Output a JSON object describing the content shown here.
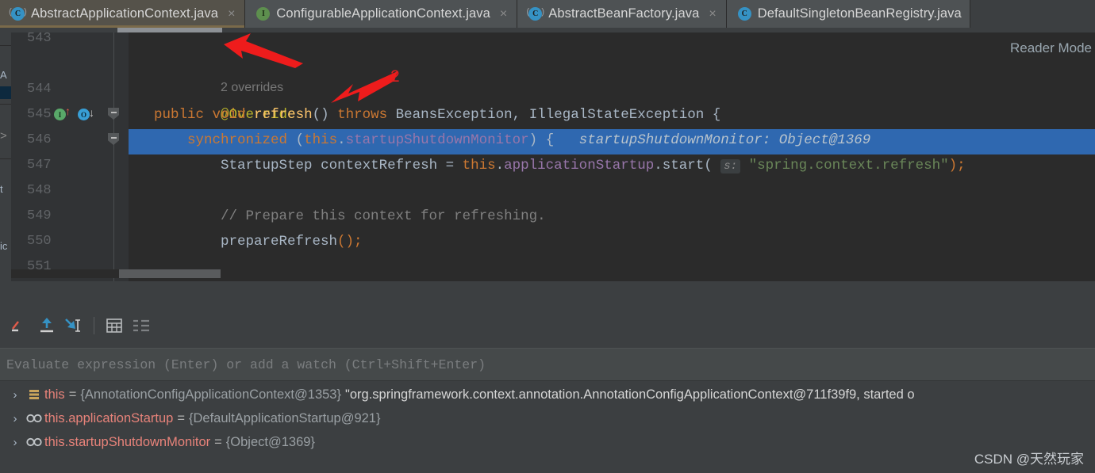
{
  "window": {
    "watermark": "CSDN @天然玩家"
  },
  "tabs": [
    {
      "label": "AbstractApplicationContext.java",
      "icon": "abstract-class-icon",
      "icon_letter": "C",
      "active": true,
      "close": "×"
    },
    {
      "label": "ConfigurableApplicationContext.java",
      "icon": "interface-icon",
      "icon_letter": "I",
      "active": false,
      "close": "×"
    },
    {
      "label": "AbstractBeanFactory.java",
      "icon": "abstract-class-icon",
      "icon_letter": "C",
      "active": false,
      "close": "×"
    },
    {
      "label": "DefaultSingletonBeanRegistry.java",
      "icon": "class-icon",
      "icon_letter": "C",
      "active": false,
      "close": ""
    }
  ],
  "editor": {
    "reader_mode_label": "Reader Mode",
    "overrides_hint": "2 overrides",
    "line_numbers": [
      "543",
      "544",
      "545",
      "546",
      "547",
      "548",
      "549",
      "550",
      "551"
    ],
    "selected_line": "546",
    "gutter_icons": {
      "implements_letter": "I",
      "overrides_letter": "O",
      "implements_arrow": "↑",
      "overrides_arrow": "↓"
    },
    "code": {
      "l544_annotation": "@Override",
      "l545": {
        "kw_public": "public",
        "kw_void": "void",
        "method": "refresh",
        "parens": "()",
        "kw_throws": "throws",
        "type1": "BeansException",
        "comma": ",",
        "type2": "IllegalStateException",
        "brace": "{"
      },
      "l546": {
        "kw_sync": "synchronized",
        "open_paren": "(",
        "kw_this": "this",
        "dot": ".",
        "field": "startupShutdownMonitor",
        "close_paren": ")",
        "brace": "{",
        "debug_hint": "startupShutdownMonitor: Object@1369"
      },
      "l547": {
        "type": "StartupStep",
        "var": "contextRefresh",
        "eq": "=",
        "kw_this": "this",
        "dot": ".",
        "field": "applicationStartup",
        "dot2": ".",
        "method": "start",
        "open_paren": "(",
        "param_hint": "s:",
        "string": "\"spring.context.refresh\"",
        "close": ");"
      },
      "l549_comment": "// Prepare this context for refreshing.",
      "l550": {
        "method": "prepareRefresh",
        "tail": "();"
      }
    },
    "annotations": {
      "arrow1": "red-arrow-upper-left",
      "arrow2": "red-arrow-lower-left",
      "number_label": "2"
    }
  },
  "left_sliver": {
    "rows": [
      "A",
      "",
      ">",
      "t",
      "ic"
    ]
  },
  "debugger": {
    "toolbar": [
      {
        "name": "step-over-icon",
        "glyph": "step-over"
      },
      {
        "name": "step-out-icon",
        "glyph": "arrow-up"
      },
      {
        "name": "run-to-cursor-icon",
        "glyph": "arrow-down-right"
      },
      {
        "name": "table-view-icon",
        "glyph": "table"
      },
      {
        "name": "list-view-icon",
        "glyph": "list"
      }
    ],
    "evaluate_placeholder": "Evaluate expression (Enter) or add a watch (Ctrl+Shift+Enter)",
    "variables": [
      {
        "chevron": "›",
        "icon": "frame-variable-icon",
        "name": "this",
        "eq": "=",
        "value": "{AnnotationConfigApplicationContext@1353}",
        "string": "\"org.springframework.context.annotation.AnnotationConfigApplicationContext@711f39f9, started o"
      },
      {
        "chevron": "›",
        "icon": "watch-variable-icon",
        "name": "this.applicationStartup",
        "eq": "=",
        "value": "{DefaultApplicationStartup@921}",
        "string": ""
      },
      {
        "chevron": "›",
        "icon": "watch-variable-icon",
        "name": "this.startupShutdownMonitor",
        "eq": "=",
        "value": "{Object@1369}",
        "string": ""
      }
    ]
  },
  "colors": {
    "editor_bg": "#2b2b2b",
    "gutter_bg": "#313335",
    "panel_bg": "#3c3f41",
    "selection_blue": "#2f68b0",
    "keyword_orange": "#cc7832",
    "method_yellow": "#ffc66d",
    "field_purple": "#9876aa",
    "string_green": "#6a8759",
    "comment_gray": "#808080",
    "annotation_red": "#e02020",
    "var_name_red": "#e8837a"
  }
}
